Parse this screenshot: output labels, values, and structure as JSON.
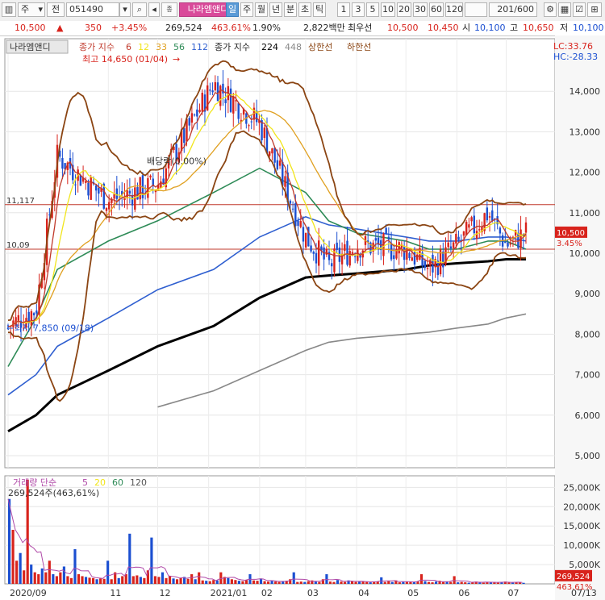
{
  "toolbar": {
    "type_select": "주",
    "market_select": "전",
    "stock_code": "051490",
    "stock_name": "나라엠앤디",
    "periods": [
      "일",
      "주",
      "월",
      "년",
      "분",
      "초",
      "틱"
    ],
    "active_period": "일",
    "intervals": [
      "1",
      "3",
      "5",
      "10",
      "20",
      "30",
      "60",
      "120"
    ],
    "count": "201",
    "count_total": "/600"
  },
  "quote": {
    "price": "10,500",
    "change": "350",
    "change_pct": "+3.45%",
    "volume": "269,524",
    "volume_pct": "463.61%",
    "turnover_pct": "1.90%",
    "amount": "2,822백만",
    "priority_label": "최우선",
    "ask": "10,500",
    "bid": "10,450",
    "open_label": "시",
    "open": "10,100",
    "high_label": "고",
    "high": "10,650",
    "low_label": "저",
    "low": "10,100"
  },
  "colors": {
    "up": "#d8231c",
    "down": "#1b4fd1",
    "ma6": "#c0392b",
    "ma12": "#f1e51b",
    "ma33": "#e0a020",
    "ma56": "#2e8b57",
    "ma112": "#2f5fd0",
    "ma224": "#000000",
    "ma448": "#888888",
    "envelope": "#8b4513",
    "resistance": "#c0392b"
  },
  "chart_data": [
    {
      "type": "candlestick",
      "panel": "price",
      "name_tab": "나라엠앤디",
      "legend": [
        {
          "name": "종가 지수",
          "values": [
            "6",
            "12",
            "33",
            "56",
            "112"
          ]
        },
        {
          "name": "종가 지수",
          "values": [
            "224",
            "448"
          ]
        },
        {
          "name": "상한선",
          "values": []
        },
        {
          "name": "하한선",
          "values": []
        }
      ],
      "annotations": {
        "high": "최고 14,650 (01/04)",
        "low": "최저 7,850 (09/18)",
        "dividend": "배당락(0.00%)",
        "lc": "LC:33.76",
        "hc": "HC:-28.33",
        "line_upper_label": "11,117",
        "line_lower_label": "10,09",
        "current_price_tag": "10,500",
        "current_pct_tag": "3.45%"
      },
      "y_ticks": [
        "14,000",
        "13,000",
        "12,000",
        "11,000",
        "10,000",
        "9,000",
        "8,000",
        "7,000",
        "6,000",
        "5,000"
      ],
      "y_tick_values": [
        14000,
        13000,
        12000,
        11000,
        10000,
        9000,
        8000,
        7000,
        6000,
        5000
      ],
      "ylim": [
        4700,
        15300
      ],
      "x_ticks": [
        "2020/09",
        "11",
        "12",
        "2021/01",
        "02",
        "03",
        "04",
        "05",
        "06",
        "07",
        "07/13"
      ],
      "horizontal_lines": [
        11200,
        10100
      ],
      "price_anchors": {
        "dates": [
          "2020/09/01",
          "2020/09/18",
          "2020/10/01",
          "2020/11/01",
          "2020/12/01",
          "2021/01/04",
          "2021/02/01",
          "2021/03/01",
          "2021/03/15",
          "2021/04/01",
          "2021/05/01",
          "2021/05/15",
          "2021/06/01",
          "2021/06/20",
          "2021/07/01",
          "2021/07/13"
        ],
        "close": [
          8200,
          8600,
          12400,
          11300,
          11700,
          14200,
          13200,
          10400,
          9700,
          10200,
          10100,
          9600,
          10200,
          11000,
          10200,
          10500
        ]
      },
      "ma_series": [
        {
          "key": "ma224",
          "period": "224",
          "values": [
            5600,
            6000,
            6500,
            7100,
            7700,
            8200,
            8900,
            9400,
            9450,
            9500,
            9600,
            9700,
            9750,
            9800,
            9850,
            9850
          ]
        },
        {
          "key": "ma448",
          "period": "448",
          "values": [
            null,
            null,
            null,
            null,
            6200,
            6600,
            7100,
            7600,
            7800,
            7900,
            8000,
            8050,
            8150,
            8250,
            8400,
            8500
          ]
        },
        {
          "key": "ma112",
          "period": "112",
          "values": [
            6500,
            7000,
            7700,
            8400,
            9100,
            9600,
            10400,
            10900,
            10700,
            10600,
            10400,
            10300,
            10300,
            10400,
            10400,
            10300
          ]
        },
        {
          "key": "ma56",
          "period": "56",
          "values": [
            7200,
            8400,
            9600,
            10300,
            10800,
            11500,
            12100,
            11500,
            10800,
            10500,
            10300,
            10100,
            10100,
            10300,
            10300,
            10100
          ]
        }
      ]
    },
    {
      "type": "bar",
      "panel": "volume",
      "legend": [
        {
          "name": "거래량 단순",
          "values": [
            "5",
            "20",
            "60",
            "120"
          ]
        }
      ],
      "annotations": {
        "current": "269,524주(463,61%)",
        "current_price_tag": "269,524",
        "current_pct_tag": "463.61%"
      },
      "y_ticks": [
        "25,000K",
        "20,000K",
        "15,000K",
        "10,000K",
        "5,000K"
      ],
      "y_tick_values": [
        25000,
        20000,
        15000,
        10000,
        5000
      ],
      "ylim": [
        0,
        28000
      ],
      "values_k": [
        22000,
        14000,
        6000,
        8000,
        3500,
        27000,
        5000,
        3000,
        2500,
        4000,
        3000,
        6000,
        2500,
        2000,
        3000,
        4500,
        2000,
        1500,
        9000,
        2500,
        2000,
        1800,
        1600,
        1500,
        1200,
        1400,
        1300,
        6000,
        1200,
        3000,
        1500,
        2000,
        2500,
        13000,
        2000,
        2200,
        1800,
        1500,
        3500,
        12000,
        2000,
        1800,
        3000,
        1500,
        2000,
        1400,
        1200,
        1500,
        1800,
        1300,
        2500,
        1200,
        3000,
        900,
        800,
        700,
        1000,
        900,
        3000,
        1800,
        1500,
        1200,
        1000,
        800,
        700,
        1000,
        2500,
        900,
        800,
        1400,
        700,
        600,
        800,
        600,
        500,
        700,
        800,
        1200,
        3000,
        500,
        600,
        500,
        700,
        900,
        600,
        500,
        1200,
        2500,
        600,
        500,
        1000,
        600,
        500,
        900,
        700,
        500,
        600,
        700,
        500,
        400,
        500,
        600,
        1700,
        500,
        700,
        500,
        900,
        400,
        500,
        600,
        500,
        500,
        600,
        2500,
        700,
        500,
        400,
        600,
        800,
        500,
        600,
        500,
        2000,
        400,
        500,
        400,
        300,
        500,
        600,
        400,
        300,
        500,
        400,
        500,
        300,
        400,
        600,
        400,
        300,
        400,
        500,
        270
      ]
    }
  ]
}
